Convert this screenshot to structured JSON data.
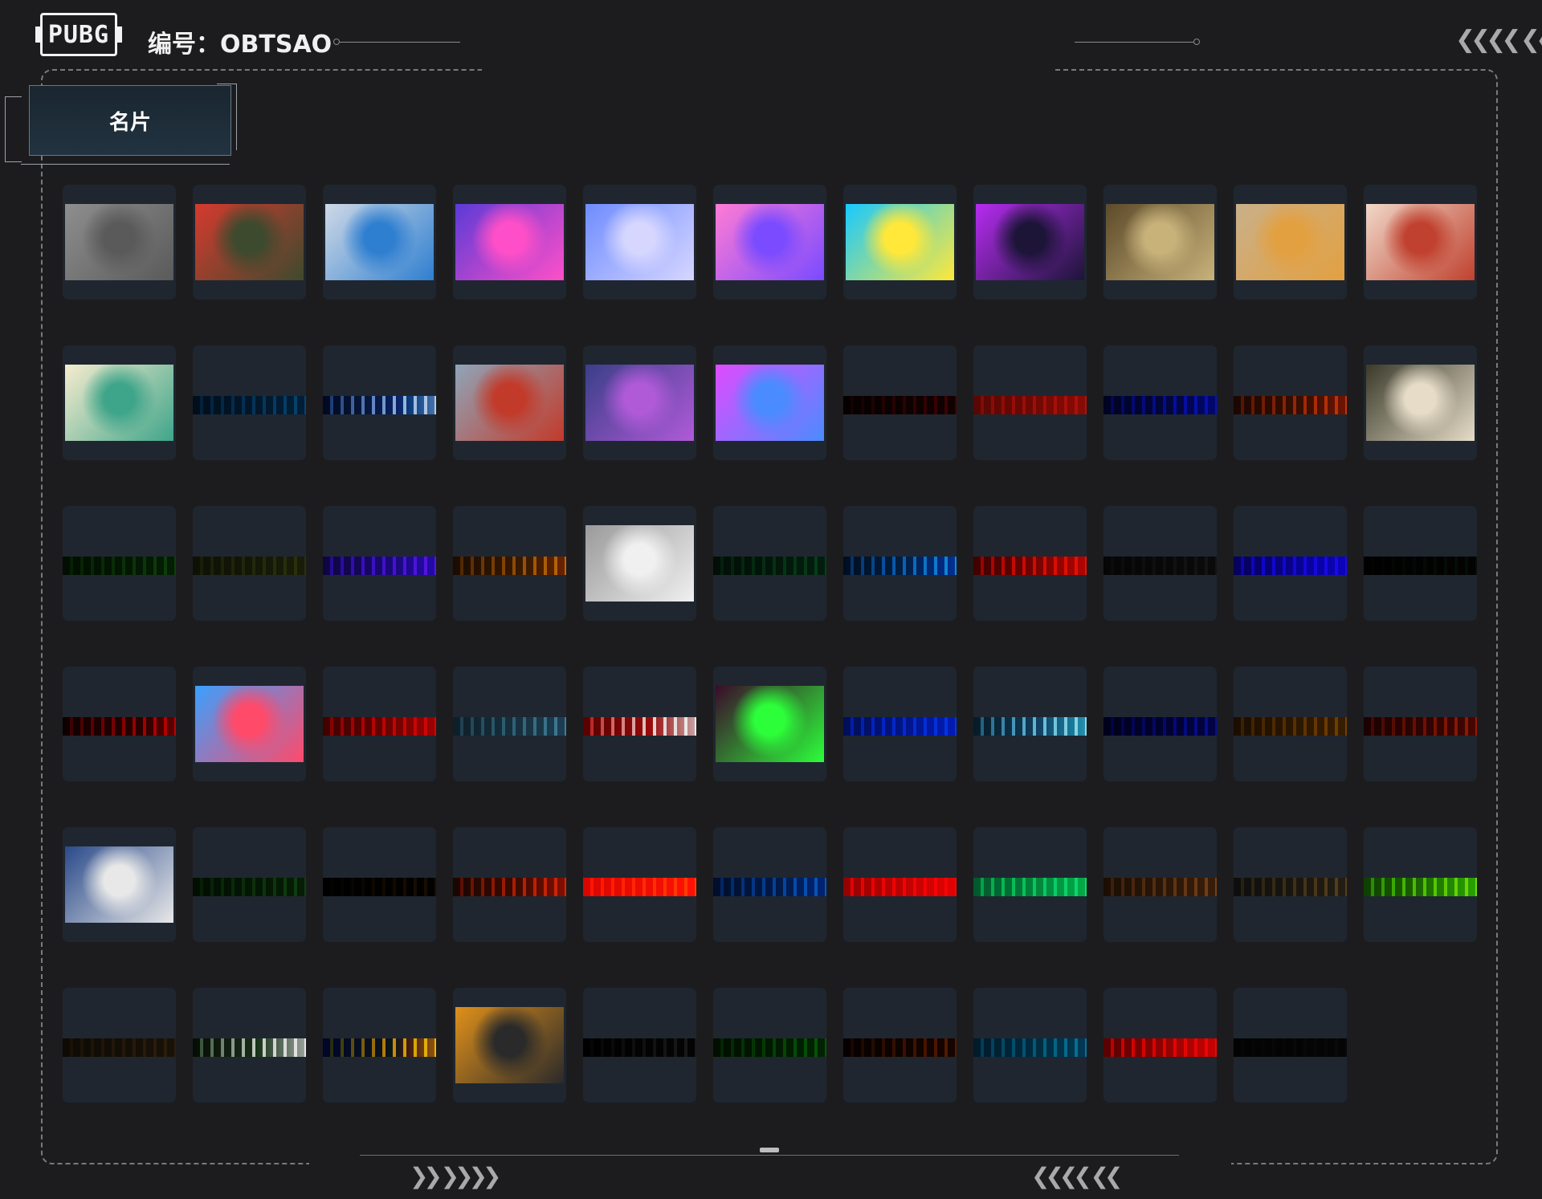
{
  "header": {
    "logo_text": "PUBG",
    "player_id_label": "编号：OBTSAO",
    "right_chevrons": "❮❮❮❮ ❮❮"
  },
  "tab": {
    "label": "名片"
  },
  "footer": {
    "left_chevrons": "❯❯ ❯❯❯❯",
    "right_chevrons": "❮❮❮❮ ❮❮"
  },
  "cards": [
    {
      "kind": "image",
      "colors": [
        "#8e8e8e",
        "#5a5a5a"
      ],
      "icon": "static-noise-icon"
    },
    {
      "kind": "image",
      "colors": [
        "#d63a2e",
        "#3d4a2e"
      ],
      "icon": "crocodile-icon"
    },
    {
      "kind": "image",
      "colors": [
        "#cfd9e6",
        "#2f7fd0"
      ],
      "icon": "astronaut-icon"
    },
    {
      "kind": "image",
      "colors": [
        "#5b3bd6",
        "#ff4fc8"
      ],
      "icon": "neon-streak-icon"
    },
    {
      "kind": "image",
      "colors": [
        "#6f8cff",
        "#d6d6ff"
      ],
      "icon": "pixel-cat-icon"
    },
    {
      "kind": "image",
      "colors": [
        "#ff7bd5",
        "#7a4bff"
      ],
      "icon": "anime-girl-icon"
    },
    {
      "kind": "image",
      "colors": [
        "#18c9ff",
        "#ffe83a"
      ],
      "icon": "newjeans-icon"
    },
    {
      "kind": "image",
      "colors": [
        "#b62cf0",
        "#1c1538"
      ],
      "icon": "hooded-figure-icon"
    },
    {
      "kind": "image",
      "colors": [
        "#5c4a2a",
        "#c8b27a"
      ],
      "icon": "western-scene-icon"
    },
    {
      "kind": "image",
      "colors": [
        "#c9b08a",
        "#e3a040"
      ],
      "icon": "duck-icon"
    },
    {
      "kind": "image",
      "colors": [
        "#f0d8c8",
        "#c0412f"
      ],
      "icon": "dragon-head-icon"
    },
    {
      "kind": "image",
      "colors": [
        "#f6eccf",
        "#3fa58a"
      ],
      "icon": "dragons-icon"
    },
    {
      "kind": "band",
      "colors": [
        "#0b2a3b",
        "#1e5d78"
      ],
      "icon": "band-icon"
    },
    {
      "kind": "band",
      "colors": [
        "#0c2140",
        "#9fb0c8"
      ],
      "icon": "moon-phases-icon"
    },
    {
      "kind": "image",
      "colors": [
        "#8fa5b8",
        "#c23a2a"
      ],
      "icon": "footballer-icon"
    },
    {
      "kind": "image",
      "colors": [
        "#3a3f88",
        "#b05ad8"
      ],
      "icon": "disco-ball-icon"
    },
    {
      "kind": "image",
      "colors": [
        "#e04bff",
        "#4a8cff"
      ],
      "icon": "anime-dancer-icon"
    },
    {
      "kind": "band",
      "colors": [
        "#1a0a0a",
        "#5a1010"
      ],
      "icon": "band-icon"
    },
    {
      "kind": "band",
      "colors": [
        "#6a1e14",
        "#9a2e22"
      ],
      "icon": "band-icon"
    },
    {
      "kind": "band",
      "colors": [
        "#0a1440",
        "#1a2fa0"
      ],
      "icon": "band-icon"
    },
    {
      "kind": "band",
      "colors": [
        "#3a1e0a",
        "#a4531c"
      ],
      "icon": "band-icon"
    },
    {
      "kind": "image",
      "colors": [
        "#3a3a2a",
        "#e6dcc8"
      ],
      "icon": "playing-cards-icon"
    },
    {
      "kind": "band",
      "colors": [
        "#0e2a0e",
        "#2c5a24"
      ],
      "icon": "band-icon"
    },
    {
      "kind": "band",
      "colors": [
        "#2a2e1a",
        "#4a5028"
      ],
      "icon": "band-icon"
    },
    {
      "kind": "band",
      "colors": [
        "#2a1a5a",
        "#6a34c0"
      ],
      "icon": "band-icon"
    },
    {
      "kind": "band",
      "colors": [
        "#3a2608",
        "#a07420"
      ],
      "icon": "band-icon"
    },
    {
      "kind": "image",
      "colors": [
        "#9a9a9a",
        "#f0f0f0"
      ],
      "icon": "bird-icon"
    },
    {
      "kind": "band",
      "colors": [
        "#0e2a1e",
        "#1f5a3a"
      ],
      "icon": "band-icon"
    },
    {
      "kind": "band",
      "colors": [
        "#0a2a40",
        "#2a86b8"
      ],
      "icon": "band-icon"
    },
    {
      "kind": "band",
      "colors": [
        "#5a0a0a",
        "#c43018"
      ],
      "icon": "band-icon"
    },
    {
      "kind": "band",
      "colors": [
        "#1a1a1a",
        "#333333"
      ],
      "icon": "band-icon"
    },
    {
      "kind": "band",
      "colors": [
        "#1a0a6a",
        "#3a24c8"
      ],
      "icon": "band-icon"
    },
    {
      "kind": "band",
      "colors": [
        "#0a0a0a",
        "#1c2a1c"
      ],
      "icon": "band-icon"
    },
    {
      "kind": "band",
      "colors": [
        "#2a0404",
        "#a01212"
      ],
      "icon": "band-icon"
    },
    {
      "kind": "image",
      "colors": [
        "#3aa0ff",
        "#ff4a6a"
      ],
      "icon": "pilot-icon"
    },
    {
      "kind": "band",
      "colors": [
        "#5a0a0a",
        "#b21c1c"
      ],
      "icon": "band-icon"
    },
    {
      "kind": "band",
      "colors": [
        "#2a3e48",
        "#5a7e8a"
      ],
      "icon": "mountains-icon"
    },
    {
      "kind": "band",
      "colors": [
        "#6a0a0a",
        "#d0d0d0"
      ],
      "icon": "band-icon"
    },
    {
      "kind": "image",
      "colors": [
        "#3a0a2a",
        "#2cff3a"
      ],
      "icon": "game-over-icon"
    },
    {
      "kind": "band",
      "colors": [
        "#0a2a6a",
        "#1a52c0"
      ],
      "icon": "band-icon"
    },
    {
      "kind": "band",
      "colors": [
        "#1a3a48",
        "#8ab8c8"
      ],
      "icon": "band-icon"
    },
    {
      "kind": "band",
      "colors": [
        "#0a0a3a",
        "#1a2a8a"
      ],
      "icon": "band-icon"
    },
    {
      "kind": "band",
      "colors": [
        "#3a2a0a",
        "#7a5a14"
      ],
      "icon": "band-icon"
    },
    {
      "kind": "band",
      "colors": [
        "#3a0e0e",
        "#8a3a1a"
      ],
      "icon": "band-icon"
    },
    {
      "kind": "image",
      "colors": [
        "#2a4a8a",
        "#e8e8e8"
      ],
      "icon": "money-man-icon"
    },
    {
      "kind": "band",
      "colors": [
        "#102a10",
        "#2e5a2e"
      ],
      "icon": "band-icon"
    },
    {
      "kind": "band",
      "colors": [
        "#050505",
        "#3a2a10"
      ],
      "icon": "band-icon"
    },
    {
      "kind": "band",
      "colors": [
        "#3a1a08",
        "#b0481a"
      ],
      "icon": "band-icon"
    },
    {
      "kind": "band",
      "colors": [
        "#b81a0a",
        "#ff5a1a"
      ],
      "icon": "band-icon"
    },
    {
      "kind": "band",
      "colors": [
        "#0a2a4a",
        "#1e6aa0"
      ],
      "icon": "band-icon"
    },
    {
      "kind": "band",
      "colors": [
        "#8a0a0a",
        "#e01a1a"
      ],
      "icon": "band-icon"
    },
    {
      "kind": "band",
      "colors": [
        "#0a6a4a",
        "#2ab87a"
      ],
      "icon": "band-icon"
    },
    {
      "kind": "band",
      "colors": [
        "#3a2a18",
        "#7a5a38"
      ],
      "icon": "band-icon"
    },
    {
      "kind": "band",
      "colors": [
        "#2a2a2a",
        "#6a5a3a"
      ],
      "icon": "band-icon"
    },
    {
      "kind": "band",
      "colors": [
        "#2a5a0a",
        "#7ab81a"
      ],
      "icon": "band-icon"
    },
    {
      "kind": "band",
      "colors": [
        "#2a2418",
        "#4a3e2a"
      ],
      "icon": "band-icon"
    },
    {
      "kind": "band",
      "colors": [
        "#1a2a1a",
        "#c8c8c8"
      ],
      "icon": "band-icon"
    },
    {
      "kind": "band",
      "colors": [
        "#0a1a4a",
        "#c8a01a"
      ],
      "icon": "band-icon"
    },
    {
      "kind": "image",
      "colors": [
        "#e0901a",
        "#2a2a2a"
      ],
      "icon": "tiger-icon"
    },
    {
      "kind": "band",
      "colors": [
        "#0a0a0a",
        "#3a3a3a"
      ],
      "icon": "band-icon"
    },
    {
      "kind": "band",
      "colors": [
        "#0a2a0a",
        "#1e6a1e"
      ],
      "icon": "band-icon"
    },
    {
      "kind": "band",
      "colors": [
        "#1a0a04",
        "#6a3a10"
      ],
      "icon": "band-icon"
    },
    {
      "kind": "band",
      "colors": [
        "#0a3a4a",
        "#1e7a8a"
      ],
      "icon": "band-icon"
    },
    {
      "kind": "band",
      "colors": [
        "#6a0a0a",
        "#d01a1a"
      ],
      "icon": "band-icon"
    },
    {
      "kind": "band",
      "colors": [
        "#141414",
        "#222222"
      ],
      "icon": "band-icon"
    }
  ]
}
